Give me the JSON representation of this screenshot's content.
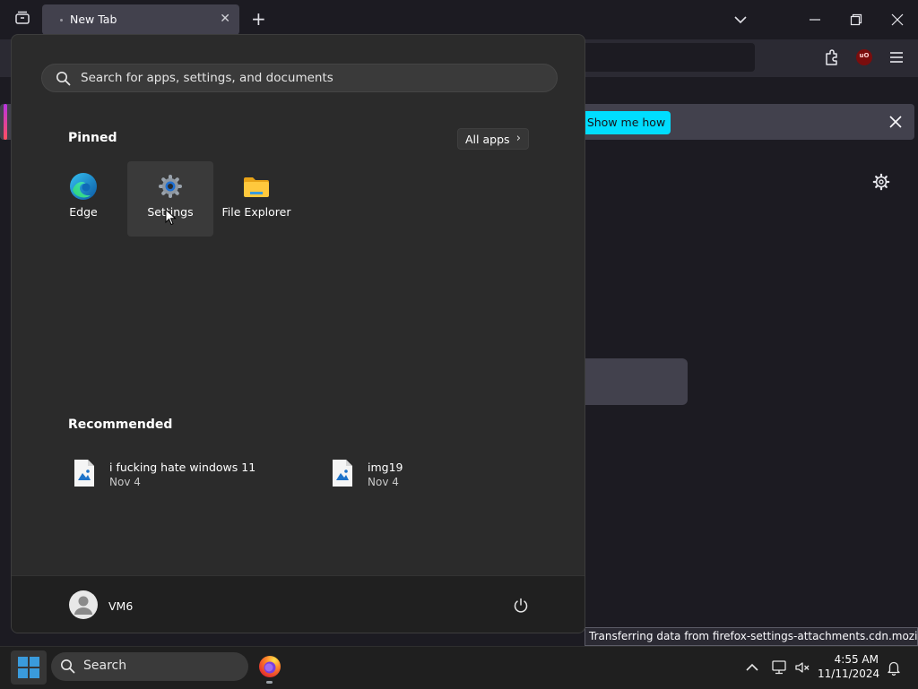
{
  "browser": {
    "tab": {
      "title": "New Tab"
    },
    "notification": {
      "action_label": "Show me how"
    },
    "status_text": "Transferring data from firefox-settings-attachments.cdn.mozilla.net..."
  },
  "start_menu": {
    "search_placeholder": "Search for apps, settings, and documents",
    "pinned_title": "Pinned",
    "all_apps_label": "All apps",
    "pinned": [
      {
        "label": "Edge",
        "icon": "edge-icon"
      },
      {
        "label": "Settings",
        "icon": "gear-icon"
      },
      {
        "label": "File Explorer",
        "icon": "folder-icon"
      }
    ],
    "recommended_title": "Recommended",
    "recommended": [
      {
        "name": "i fucking hate windows 11",
        "date": "Nov 4",
        "icon": "image-file-icon"
      },
      {
        "name": "img19",
        "date": "Nov 4",
        "icon": "image-file-icon"
      }
    ],
    "user_name": "VM6"
  },
  "taskbar": {
    "search_label": "Search",
    "time": "4:55 AM",
    "date": "11/11/2024"
  },
  "colors": {
    "accent_cyan": "#00ddff",
    "start_bg": "#2b2b2b",
    "taskbar_bg": "#1f1f1f",
    "windows_blue": "#3a9bdc"
  }
}
